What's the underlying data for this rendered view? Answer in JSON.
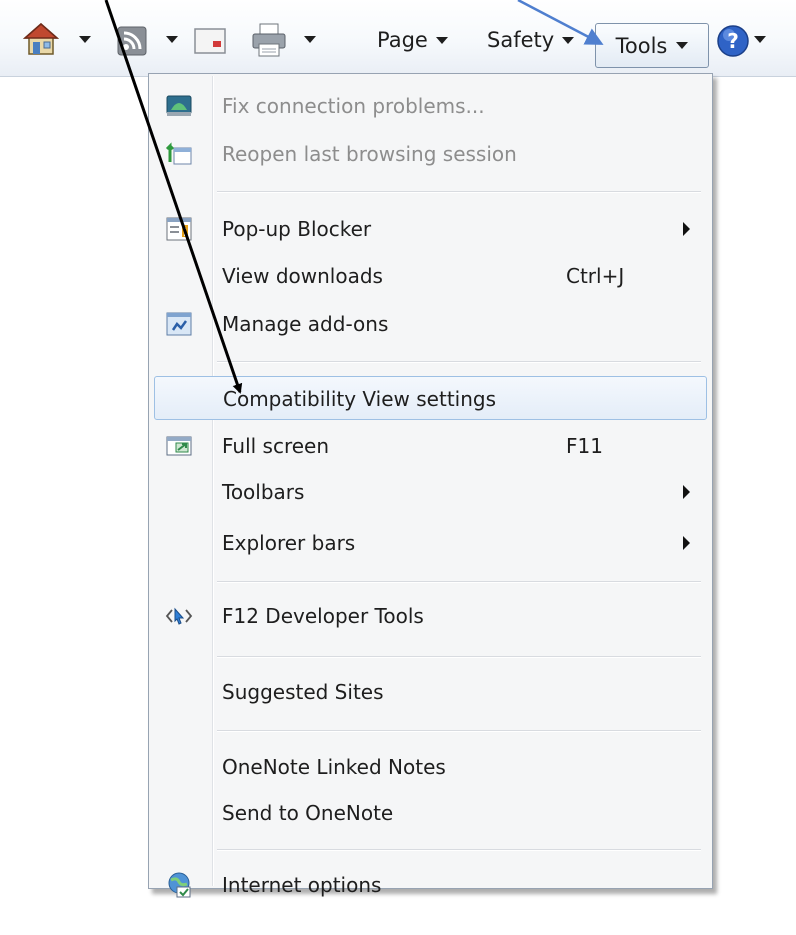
{
  "command_bar": {
    "home_icon": "home-icon",
    "feeds_icon": "rss-feeds-icon",
    "mail_icon": "read-mail-icon",
    "print_icon": "printer-icon",
    "page_label": "Page",
    "safety_label": "Safety",
    "tools_label": "Tools",
    "help_icon": "help-icon"
  },
  "tools_menu": {
    "items": [
      {
        "label": "Fix connection problems...",
        "disabled": true,
        "icon": "network-diagnose-icon"
      },
      {
        "label": "Reopen last browsing session",
        "disabled": true,
        "icon": "reopen-session-icon"
      },
      {
        "label": "Pop-up Blocker",
        "submenu": true,
        "icon": "popup-blocker-icon"
      },
      {
        "label": "View downloads",
        "shortcut": "Ctrl+J"
      },
      {
        "label": "Manage add-ons",
        "icon": "manage-addons-icon"
      },
      {
        "label": "Compatibility View settings",
        "highlighted": true
      },
      {
        "label": "Full screen",
        "shortcut": "F11",
        "icon": "full-screen-icon"
      },
      {
        "label": "Toolbars",
        "submenu": true
      },
      {
        "label": "Explorer bars",
        "submenu": true
      },
      {
        "label": "F12 Developer Tools",
        "icon": "developer-tools-icon"
      },
      {
        "label": "Suggested Sites"
      },
      {
        "label": "OneNote Linked Notes"
      },
      {
        "label": "Send to OneNote"
      },
      {
        "label": "Internet options",
        "icon": "internet-options-icon"
      }
    ]
  },
  "annotation_colors": {
    "black_arrow": "#000000",
    "blue_arrow": "#4f7fcf"
  }
}
